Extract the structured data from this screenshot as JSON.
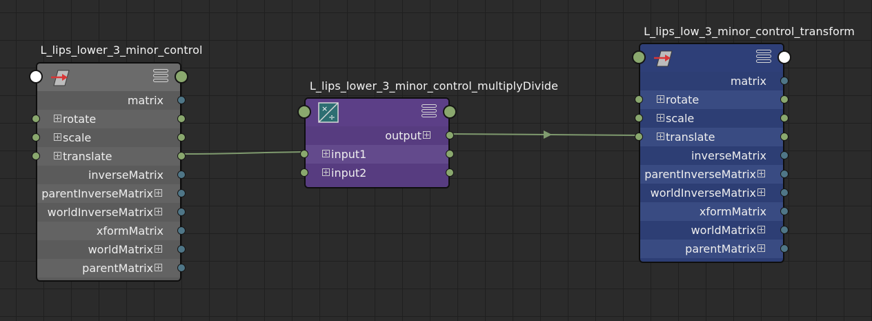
{
  "nodes": {
    "control": {
      "title": "L_lips_lower_3_minor_control",
      "icon": "transform-icon",
      "rows": [
        {
          "label": "matrix"
        },
        {
          "label": "rotate"
        },
        {
          "label": "scale"
        },
        {
          "label": "translate"
        },
        {
          "label": "inverseMatrix"
        },
        {
          "label": "parentInverseMatrix"
        },
        {
          "label": "worldInverseMatrix"
        },
        {
          "label": "xformMatrix"
        },
        {
          "label": "worldMatrix"
        },
        {
          "label": "parentMatrix"
        }
      ]
    },
    "multiply": {
      "title": "L_lips_lower_3_minor_control_multiplyDivide",
      "icon": "multiply-divide-icon",
      "rows": [
        {
          "label": "output"
        },
        {
          "label": "input1"
        },
        {
          "label": "input2"
        }
      ]
    },
    "transform": {
      "title": "L_lips_low_3_minor_control_transform",
      "icon": "transform-icon",
      "rows": [
        {
          "label": "matrix"
        },
        {
          "label": "rotate"
        },
        {
          "label": "scale"
        },
        {
          "label": "translate"
        },
        {
          "label": "inverseMatrix"
        },
        {
          "label": "parentInverseMatrix"
        },
        {
          "label": "worldInverseMatrix"
        },
        {
          "label": "xformMatrix"
        },
        {
          "label": "worldMatrix"
        },
        {
          "label": "parentMatrix"
        }
      ]
    }
  },
  "colors": {
    "control_header": "#6b6b6b",
    "control_row_a": "#5b5b5b",
    "control_row_b": "#636363",
    "multiply_header": "#5c3f87",
    "multiply_row_a": "#573c80",
    "multiply_row_b": "#634a8c",
    "transform_header": "#2e3f78",
    "transform_row_a": "#2d3e74",
    "transform_row_b": "#394b82",
    "wire": "#7f9a6e",
    "port_green": "#8aa86e",
    "port_blue": "#4f7687"
  }
}
